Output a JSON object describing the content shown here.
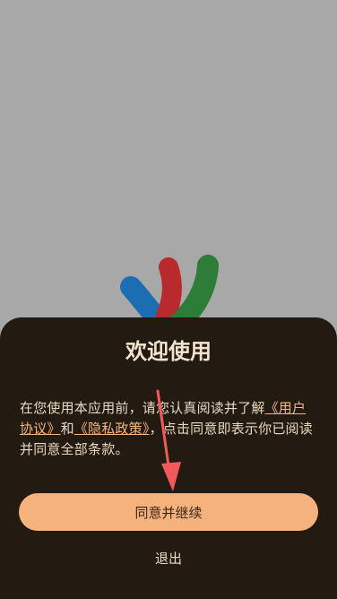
{
  "logo": {
    "icon": "colorful-logo-icon",
    "colors": [
      "#1d6db3",
      "#b82a2b",
      "#2d7d38"
    ]
  },
  "dialog": {
    "title": "欢迎使用",
    "text_before": "在您使用本应用前，请您认真阅读并了解",
    "link_user_agreement": "《用户协议》",
    "text_middle": "和",
    "link_privacy_policy": "《隐私政策》",
    "text_after": "，点击同意即表示你已阅读并同意全部条款。",
    "agree_label": "同意并继续",
    "exit_label": "退出"
  },
  "colors": {
    "backdrop": "#a8a8a8",
    "sheet": "#231a12",
    "accent": "#f5b27c",
    "annotation_arrow": "#f05a5a"
  },
  "annotation": {
    "icon": "red-arrow-icon"
  }
}
